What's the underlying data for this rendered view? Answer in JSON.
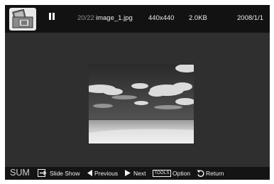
{
  "header": {
    "counter": "20/22",
    "filename": "image_1.jpg",
    "resolution": "440x440",
    "filesize": "2.0KB",
    "date": "2008/1/1",
    "folder_icon": "photo-folder-icon",
    "status_icon": "pause-icon"
  },
  "photo": {
    "subject": "clouds-over-sea-photo"
  },
  "footer": {
    "mode": "SUM",
    "slideshow_label": "Slide Show",
    "previous_label": "Previous",
    "next_label": "Next",
    "tools_badge": "TOOLS",
    "option_label": "Option",
    "return_label": "Return"
  },
  "colors": {
    "screen_bg": "#2f2f2f",
    "header_bg": "#121212",
    "footer_bg": "#141414",
    "counter_text": "#8f8f8f"
  }
}
